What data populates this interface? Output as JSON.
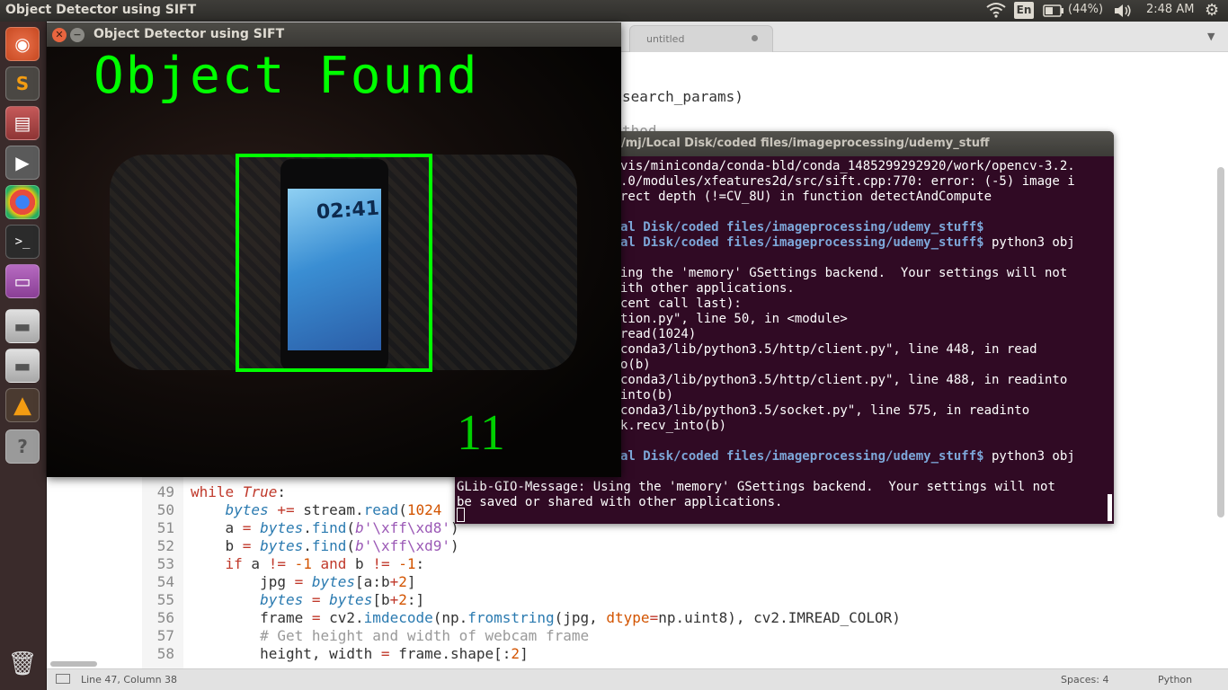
{
  "topbar": {
    "app_title": "Object Detector using SIFT",
    "wifi_icon": "wifi-icon",
    "language": "En",
    "battery": "(44%)",
    "volume_icon": "volume-icon",
    "time": "2:48 AM",
    "gear_icon": "gear-icon"
  },
  "launcher": {
    "items": [
      "ubuntu-dash",
      "sublime-text",
      "file-manager",
      "video-editor",
      "chrome",
      "terminal",
      "screenshot",
      "disk",
      "disk2",
      "vlc",
      "help"
    ],
    "trash": "trash"
  },
  "editor": {
    "tab": "untitled",
    "top_line_1": "search_params)",
    "top_line_2": "thod",
    "lines": [
      {
        "n": "49",
        "t": "while True:"
      },
      {
        "n": "50",
        "t": "    bytes += stream.read(1024"
      },
      {
        "n": "51",
        "t": "    a = bytes.find(b'\\xff\\xd8')"
      },
      {
        "n": "52",
        "t": "    b = bytes.find(b'\\xff\\xd9')"
      },
      {
        "n": "53",
        "t": "    if a != -1 and b != -1:"
      },
      {
        "n": "54",
        "t": "        jpg = bytes[a:b+2]"
      },
      {
        "n": "55",
        "t": "        bytes = bytes[b+2:]"
      },
      {
        "n": "56",
        "t": "        frame = cv2.imdecode(np.fromstring(jpg, dtype=np.uint8), cv2.IMREAD_COLOR)"
      },
      {
        "n": "57",
        "t": "        # Get height and width of webcam frame"
      },
      {
        "n": "58",
        "t": "        height, width = frame.shape[:2]"
      },
      {
        "n": "59",
        "t": ""
      }
    ],
    "status": {
      "position": "Line 47, Column 38",
      "spaces": "Spaces: 4",
      "syntax": "Python"
    }
  },
  "terminal": {
    "title": "/mj/Local Disk/coded files/imageprocessing/udemy_stuff",
    "lines": [
      {
        "t": "vis/miniconda/conda-bld/conda_1485299292920/work/opencv-3.2.",
        "b": false
      },
      {
        "t": ".0/modules/xfeatures2d/src/sift.cpp:770: error: (-5) image i",
        "b": false
      },
      {
        "t": "rect depth (!=CV_8U) in function detectAndCompute",
        "b": false
      },
      {
        "t": "",
        "b": false
      },
      {
        "t": "al Disk/coded files/imageprocessing/udemy_stuff$",
        "b": true
      },
      {
        "t": "al Disk/coded files/imageprocessing/udemy_stuff$ python3 obj",
        "b": true
      },
      {
        "t": "",
        "b": false
      },
      {
        "t": "ing the 'memory' GSettings backend.  Your settings will not",
        "b": false
      },
      {
        "t": "ith other applications.",
        "b": false
      },
      {
        "t": "cent call last):",
        "b": false
      },
      {
        "t": "tion.py\", line 50, in <module>",
        "b": false
      },
      {
        "t": "read(1024)",
        "b": false
      },
      {
        "t": "conda3/lib/python3.5/http/client.py\", line 448, in read",
        "b": false
      },
      {
        "t": "o(b)",
        "b": false
      },
      {
        "t": "conda3/lib/python3.5/http/client.py\", line 488, in readinto",
        "b": false
      },
      {
        "t": "into(b)",
        "b": false
      },
      {
        "t": "conda3/lib/python3.5/socket.py\", line 575, in readinto",
        "b": false
      },
      {
        "t": "k.recv_into(b)",
        "b": false
      },
      {
        "t": "",
        "b": false
      },
      {
        "t": "al Disk/coded files/imageprocessing/udemy_stuff$ python3 obj",
        "b": true
      }
    ],
    "msg_1": "GLib-GIO-Message: Using the 'memory' GSettings backend.  Your settings will not",
    "msg_2": "be saved or shared with other applications."
  },
  "detector": {
    "title": "Object Detector using SIFT",
    "overlay_text": "Object Found",
    "match_count": "11",
    "phone_clock": "02:41"
  }
}
